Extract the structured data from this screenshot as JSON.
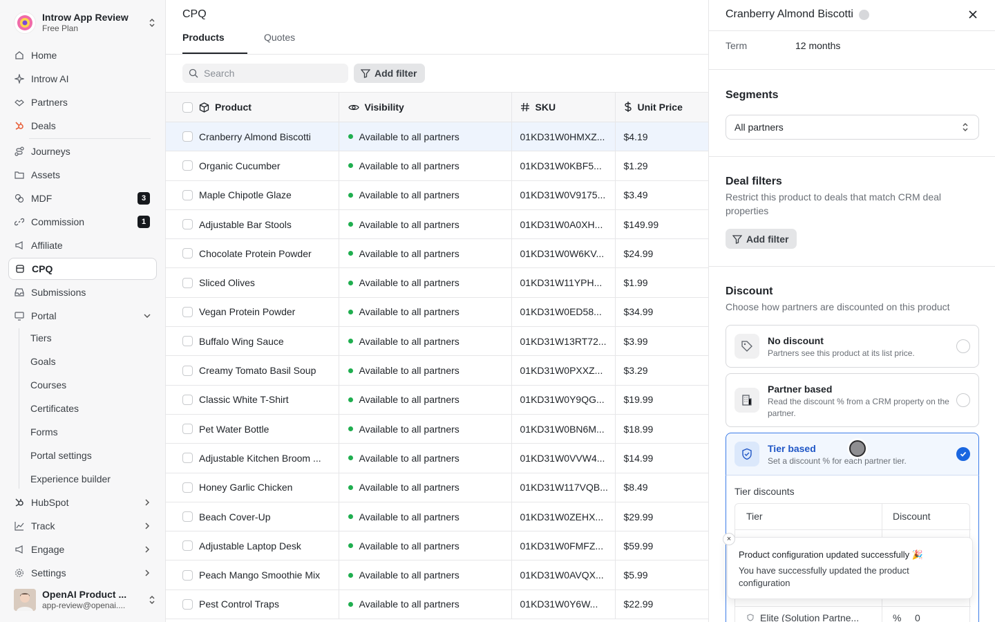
{
  "workspace": {
    "name": "Introw App Review",
    "plan": "Free Plan"
  },
  "nav": {
    "home": "Home",
    "ai": "Introw AI",
    "partners": "Partners",
    "deals": "Deals",
    "journeys": "Journeys",
    "assets": "Assets",
    "mdf": "MDF",
    "mdf_badge": "3",
    "commission": "Commission",
    "commission_badge": "1",
    "affiliate": "Affiliate",
    "cpq": "CPQ",
    "submissions": "Submissions",
    "portal": "Portal",
    "portal_sub": [
      "Tiers",
      "Goals",
      "Courses",
      "Certificates",
      "Forms",
      "Portal settings",
      "Experience builder"
    ],
    "hubspot": "HubSpot",
    "track": "Track",
    "engage": "Engage",
    "settings": "Settings"
  },
  "user": {
    "name": "OpenAI Product ...",
    "email": "app-review@openai...."
  },
  "main": {
    "title": "CPQ",
    "tabs": [
      "Products",
      "Quotes"
    ],
    "search_placeholder": "Search",
    "add_filter": "Add filter",
    "columns": [
      "Product",
      "Visibility",
      "SKU",
      "Unit Price"
    ]
  },
  "products": [
    {
      "name": "Cranberry Almond Biscotti",
      "visibility": "Available to all partners",
      "sku": "01KD31W0HMXZ...",
      "price": "$4.19"
    },
    {
      "name": "Organic Cucumber",
      "visibility": "Available to all partners",
      "sku": "01KD31W0KBF5...",
      "price": "$1.29"
    },
    {
      "name": "Maple Chipotle Glaze",
      "visibility": "Available to all partners",
      "sku": "01KD31W0V9175...",
      "price": "$3.49"
    },
    {
      "name": "Adjustable Bar Stools",
      "visibility": "Available to all partners",
      "sku": "01KD31W0A0XH...",
      "price": "$149.99"
    },
    {
      "name": "Chocolate Protein Powder",
      "visibility": "Available to all partners",
      "sku": "01KD31W0W6KV...",
      "price": "$24.99"
    },
    {
      "name": "Sliced Olives",
      "visibility": "Available to all partners",
      "sku": "01KD31W11YPH...",
      "price": "$1.99"
    },
    {
      "name": "Vegan Protein Powder",
      "visibility": "Available to all partners",
      "sku": "01KD31W0ED58...",
      "price": "$34.99"
    },
    {
      "name": "Buffalo Wing Sauce",
      "visibility": "Available to all partners",
      "sku": "01KD31W13RT72...",
      "price": "$3.99"
    },
    {
      "name": "Creamy Tomato Basil Soup",
      "visibility": "Available to all partners",
      "sku": "01KD31W0PXXZ...",
      "price": "$3.29"
    },
    {
      "name": "Classic White T-Shirt",
      "visibility": "Available to all partners",
      "sku": "01KD31W0Y9QG...",
      "price": "$19.99"
    },
    {
      "name": "Pet Water Bottle",
      "visibility": "Available to all partners",
      "sku": "01KD31W0BN6M...",
      "price": "$18.99"
    },
    {
      "name": "Adjustable Kitchen Broom ...",
      "visibility": "Available to all partners",
      "sku": "01KD31W0VVW4...",
      "price": "$14.99"
    },
    {
      "name": "Honey Garlic Chicken",
      "visibility": "Available to all partners",
      "sku": "01KD31W117VQB...",
      "price": "$8.49"
    },
    {
      "name": "Beach Cover-Up",
      "visibility": "Available to all partners",
      "sku": "01KD31W0ZEHX...",
      "price": "$29.99"
    },
    {
      "name": "Adjustable Laptop Desk",
      "visibility": "Available to all partners",
      "sku": "01KD31W0FMFZ...",
      "price": "$59.99"
    },
    {
      "name": "Peach Mango Smoothie Mix",
      "visibility": "Available to all partners",
      "sku": "01KD31W0AVQX...",
      "price": "$5.99"
    },
    {
      "name": "Pest Control Traps",
      "visibility": "Available to all partners",
      "sku": "01KD31W0Y6W...",
      "price": "$22.99"
    }
  ],
  "panel": {
    "title": "Cranberry Almond Biscotti",
    "term_label": "Term",
    "term_value": "12 months",
    "segments_title": "Segments",
    "segments_value": "All partners",
    "deal_filters_title": "Deal filters",
    "deal_filters_desc": "Restrict this product to deals that match CRM deal properties",
    "add_filter": "Add filter",
    "discount_title": "Discount",
    "discount_desc": "Choose how partners are discounted on this product",
    "options": [
      {
        "title": "No discount",
        "desc": "Partners see this product at its list price."
      },
      {
        "title": "Partner based",
        "desc": "Read the discount % from a CRM property on the partner."
      },
      {
        "title": "Tier based",
        "desc": "Set a discount % for each partner tier."
      }
    ],
    "tier_discounts_label": "Tier discounts",
    "tier_col": "Tier",
    "discount_col": "Discount",
    "elite_tier": "Elite (Solution Partne...",
    "pct_symbol": "%",
    "elite_value": "0"
  },
  "toast": {
    "title": "Product configuration updated successfully 🎉",
    "desc": "You have successfully updated the product configuration",
    "close": "×"
  }
}
